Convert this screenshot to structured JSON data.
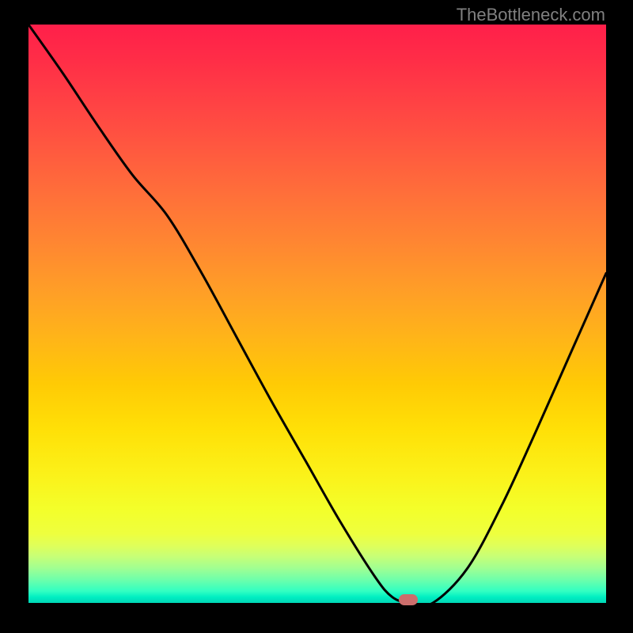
{
  "watermark": "TheBottleneck.com",
  "marker": {
    "color": "#cc6e6c",
    "cx_frac": 0.657,
    "cy_frac": 0.994
  },
  "chart_data": {
    "type": "line",
    "title": "",
    "xlabel": "",
    "ylabel": "",
    "xlim": [
      0,
      1
    ],
    "ylim": [
      0,
      1
    ],
    "legend": false,
    "grid": false,
    "annotations": [
      "TheBottleneck.com"
    ],
    "note": "Axes are unlabeled; x,y are normalized fractions of the plot area (0 = left/top edge, 1 = right/bottom edge). Higher y value = lower on screen.",
    "series": [
      {
        "name": "curve",
        "x": [
          0.0,
          0.06,
          0.12,
          0.18,
          0.24,
          0.3,
          0.36,
          0.42,
          0.48,
          0.54,
          0.6,
          0.63,
          0.66,
          0.7,
          0.76,
          0.82,
          0.88,
          0.94,
          1.0
        ],
        "y": [
          0.0,
          0.085,
          0.175,
          0.26,
          0.33,
          0.43,
          0.54,
          0.65,
          0.755,
          0.86,
          0.955,
          0.99,
          1.0,
          1.0,
          0.94,
          0.83,
          0.7,
          0.565,
          0.43
        ]
      }
    ],
    "markers": [
      {
        "name": "highlight",
        "x": 0.657,
        "y": 0.994,
        "color": "#cc6e6c"
      }
    ],
    "background_gradient": {
      "direction": "vertical",
      "stops": [
        {
          "pos": 0.0,
          "color": "#ff1f4a"
        },
        {
          "pos": 0.5,
          "color": "#ffae20"
        },
        {
          "pos": 0.8,
          "color": "#f6ff24"
        },
        {
          "pos": 1.0,
          "color": "#00d7b6"
        }
      ]
    }
  }
}
